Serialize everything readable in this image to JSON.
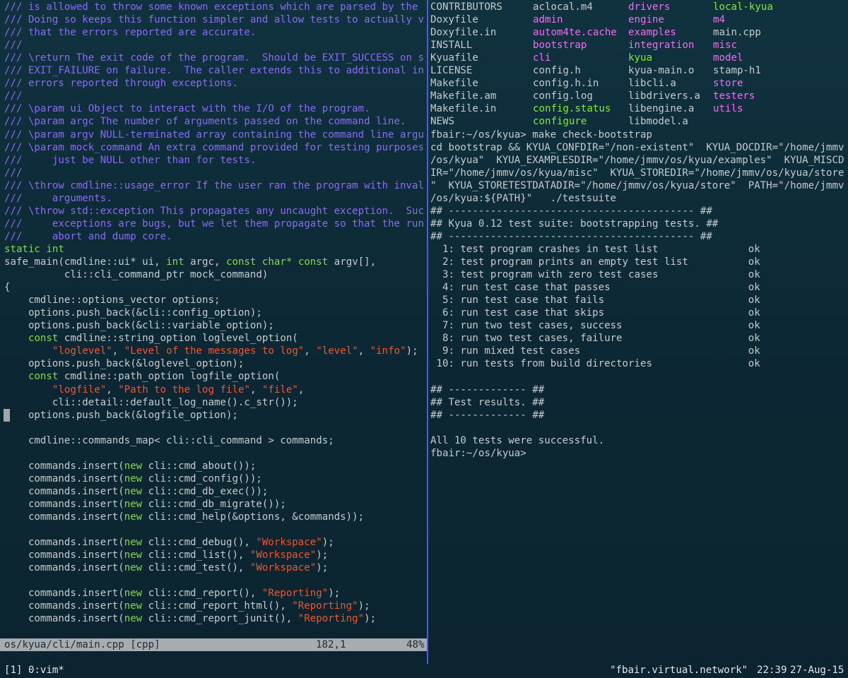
{
  "editor": {
    "lines": [
      [
        {
          "t": "/// is allowed to throw some known exceptions which are parsed by the",
          "c": "comment"
        }
      ],
      [
        {
          "t": "/// Doing so keeps this function simpler and allow tests to actually v",
          "c": "comment"
        }
      ],
      [
        {
          "t": "/// that the errors reported are accurate.",
          "c": "comment"
        }
      ],
      [
        {
          "t": "///",
          "c": "comment"
        }
      ],
      [
        {
          "t": "/// \\return The exit code of the program.  Should be EXIT_SUCCESS on s",
          "c": "comment"
        }
      ],
      [
        {
          "t": "/// EXIT_FAILURE on failure.  The caller extends this to additional in",
          "c": "comment"
        }
      ],
      [
        {
          "t": "/// errors reported through exceptions.",
          "c": "comment"
        }
      ],
      [
        {
          "t": "///",
          "c": "comment"
        }
      ],
      [
        {
          "t": "/// \\param ui Object to interact with the I/O of the program.",
          "c": "comment"
        }
      ],
      [
        {
          "t": "/// \\param argc The number of arguments passed on the command line.",
          "c": "comment"
        }
      ],
      [
        {
          "t": "/// \\param argv NULL-terminated array containing the command line argu",
          "c": "comment"
        }
      ],
      [
        {
          "t": "/// \\param mock_command An extra command provided for testing purposes",
          "c": "comment"
        }
      ],
      [
        {
          "t": "///     just be NULL other than for tests.",
          "c": "comment"
        }
      ],
      [
        {
          "t": "///",
          "c": "comment"
        }
      ],
      [
        {
          "t": "/// \\throw cmdline::usage_error If the user ran the program with inval",
          "c": "comment"
        }
      ],
      [
        {
          "t": "///     arguments.",
          "c": "comment"
        }
      ],
      [
        {
          "t": "/// \\throw std::exception This propagates any uncaught exception.  Suc",
          "c": "comment"
        }
      ],
      [
        {
          "t": "///     exceptions are bugs, but we let them propagate so that the run",
          "c": "comment"
        }
      ],
      [
        {
          "t": "///     abort and dump core.",
          "c": "comment"
        }
      ],
      [
        {
          "t": "static int",
          "c": "type"
        }
      ],
      [
        {
          "t": "safe_main(cmdline::ui* ui, ",
          "c": "plain"
        },
        {
          "t": "int",
          "c": "type"
        },
        {
          "t": " argc, ",
          "c": "plain"
        },
        {
          "t": "const char*",
          "c": "type"
        },
        {
          "t": " ",
          "c": "plain"
        },
        {
          "t": "const",
          "c": "type"
        },
        {
          "t": " argv[],",
          "c": "plain"
        }
      ],
      [
        {
          "t": "          cli::cli_command_ptr mock_command)",
          "c": "plain"
        }
      ],
      [
        {
          "t": "{",
          "c": "plain"
        }
      ],
      [
        {
          "t": "    cmdline::options_vector options;",
          "c": "plain"
        }
      ],
      [
        {
          "t": "    options.push_back(&cli::config_option);",
          "c": "plain"
        }
      ],
      [
        {
          "t": "    options.push_back(&cli::variable_option);",
          "c": "plain"
        }
      ],
      [
        {
          "t": "    ",
          "c": "plain"
        },
        {
          "t": "const",
          "c": "type"
        },
        {
          "t": " cmdline::string_option loglevel_option(",
          "c": "plain"
        }
      ],
      [
        {
          "t": "        ",
          "c": "plain"
        },
        {
          "t": "\"loglevel\"",
          "c": "str"
        },
        {
          "t": ", ",
          "c": "plain"
        },
        {
          "t": "\"Level of the messages to log\"",
          "c": "str"
        },
        {
          "t": ", ",
          "c": "plain"
        },
        {
          "t": "\"level\"",
          "c": "str"
        },
        {
          "t": ", ",
          "c": "plain"
        },
        {
          "t": "\"info\"",
          "c": "str"
        },
        {
          "t": ");",
          "c": "plain"
        }
      ],
      [
        {
          "t": "    options.push_back(&loglevel_option);",
          "c": "plain"
        }
      ],
      [
        {
          "t": "    ",
          "c": "plain"
        },
        {
          "t": "const",
          "c": "type"
        },
        {
          "t": " cmdline::path_option logfile_option(",
          "c": "plain"
        }
      ],
      [
        {
          "t": "        ",
          "c": "plain"
        },
        {
          "t": "\"logfile\"",
          "c": "str"
        },
        {
          "t": ", ",
          "c": "plain"
        },
        {
          "t": "\"Path to the log file\"",
          "c": "str"
        },
        {
          "t": ", ",
          "c": "plain"
        },
        {
          "t": "\"file\"",
          "c": "str"
        },
        {
          "t": ",",
          "c": "plain"
        }
      ],
      [
        {
          "t": "        cli::detail::default_log_name().c_str());",
          "c": "plain"
        }
      ],
      [
        {
          "t": "    options.push_back(&logfile_option);",
          "c": "plain"
        }
      ],
      [
        {
          "t": "",
          "c": "plain"
        }
      ],
      [
        {
          "t": "    cmdline::commands_map< cli::cli_command > commands;",
          "c": "plain"
        }
      ],
      [
        {
          "t": "",
          "c": "plain"
        }
      ],
      [
        {
          "t": "    commands.insert(",
          "c": "plain"
        },
        {
          "t": "new",
          "c": "type"
        },
        {
          "t": " cli::cmd_about());",
          "c": "plain"
        }
      ],
      [
        {
          "t": "    commands.insert(",
          "c": "plain"
        },
        {
          "t": "new",
          "c": "type"
        },
        {
          "t": " cli::cmd_config());",
          "c": "plain"
        }
      ],
      [
        {
          "t": "    commands.insert(",
          "c": "plain"
        },
        {
          "t": "new",
          "c": "type"
        },
        {
          "t": " cli::cmd_db_exec());",
          "c": "plain"
        }
      ],
      [
        {
          "t": "    commands.insert(",
          "c": "plain"
        },
        {
          "t": "new",
          "c": "type"
        },
        {
          "t": " cli::cmd_db_migrate());",
          "c": "plain"
        }
      ],
      [
        {
          "t": "    commands.insert(",
          "c": "plain"
        },
        {
          "t": "new",
          "c": "type"
        },
        {
          "t": " cli::cmd_help(&options, &commands));",
          "c": "plain"
        }
      ],
      [
        {
          "t": "",
          "c": "plain"
        }
      ],
      [
        {
          "t": "    commands.insert(",
          "c": "plain"
        },
        {
          "t": "new",
          "c": "type"
        },
        {
          "t": " cli::cmd_debug(), ",
          "c": "plain"
        },
        {
          "t": "\"Workspace\"",
          "c": "str"
        },
        {
          "t": ");",
          "c": "plain"
        }
      ],
      [
        {
          "t": "    commands.insert(",
          "c": "plain"
        },
        {
          "t": "new",
          "c": "type"
        },
        {
          "t": " cli::cmd_list(), ",
          "c": "plain"
        },
        {
          "t": "\"Workspace\"",
          "c": "str"
        },
        {
          "t": ");",
          "c": "plain"
        }
      ],
      [
        {
          "t": "    commands.insert(",
          "c": "plain"
        },
        {
          "t": "new",
          "c": "type"
        },
        {
          "t": " cli::cmd_test(), ",
          "c": "plain"
        },
        {
          "t": "\"Workspace\"",
          "c": "str"
        },
        {
          "t": ");",
          "c": "plain"
        }
      ],
      [
        {
          "t": "",
          "c": "plain"
        }
      ],
      [
        {
          "t": "    commands.insert(",
          "c": "plain"
        },
        {
          "t": "new",
          "c": "type"
        },
        {
          "t": " cli::cmd_report(), ",
          "c": "plain"
        },
        {
          "t": "\"Reporting\"",
          "c": "str"
        },
        {
          "t": ");",
          "c": "plain"
        }
      ],
      [
        {
          "t": "    commands.insert(",
          "c": "plain"
        },
        {
          "t": "new",
          "c": "type"
        },
        {
          "t": " cli::cmd_report_html(), ",
          "c": "plain"
        },
        {
          "t": "\"Reporting\"",
          "c": "str"
        },
        {
          "t": ");",
          "c": "plain"
        }
      ],
      [
        {
          "t": "    commands.insert(",
          "c": "plain"
        },
        {
          "t": "new",
          "c": "type"
        },
        {
          "t": " cli::cmd_report_junit(), ",
          "c": "plain"
        },
        {
          "t": "\"Reporting\"",
          "c": "str"
        },
        {
          "t": ");",
          "c": "plain"
        }
      ]
    ],
    "statusline": {
      "file": "os/kyua/cli/main.cpp [cpp]",
      "position": "182,1",
      "percent": "48%"
    }
  },
  "terminal": {
    "listing": [
      [
        {
          "t": "CONTRIBUTORS",
          "c": "file"
        },
        {
          "t": "aclocal.m4",
          "c": "file"
        },
        {
          "t": "drivers",
          "c": "dir"
        },
        {
          "t": "local-kyua",
          "c": "exe"
        }
      ],
      [
        {
          "t": "Doxyfile",
          "c": "file"
        },
        {
          "t": "admin",
          "c": "dir"
        },
        {
          "t": "engine",
          "c": "dir"
        },
        {
          "t": "m4",
          "c": "dir"
        }
      ],
      [
        {
          "t": "Doxyfile.in",
          "c": "file"
        },
        {
          "t": "autom4te.cache",
          "c": "dir"
        },
        {
          "t": "examples",
          "c": "dir"
        },
        {
          "t": "main.cpp",
          "c": "file"
        }
      ],
      [
        {
          "t": "INSTALL",
          "c": "file"
        },
        {
          "t": "bootstrap",
          "c": "dir"
        },
        {
          "t": "integration",
          "c": "dir"
        },
        {
          "t": "misc",
          "c": "dir"
        }
      ],
      [
        {
          "t": "Kyuafile",
          "c": "file"
        },
        {
          "t": "cli",
          "c": "dir"
        },
        {
          "t": "kyua",
          "c": "exe"
        },
        {
          "t": "model",
          "c": "dir"
        }
      ],
      [
        {
          "t": "LICENSE",
          "c": "file"
        },
        {
          "t": "config.h",
          "c": "file"
        },
        {
          "t": "kyua-main.o",
          "c": "file"
        },
        {
          "t": "stamp-h1",
          "c": "file"
        }
      ],
      [
        {
          "t": "Makefile",
          "c": "file"
        },
        {
          "t": "config.h.in",
          "c": "file"
        },
        {
          "t": "libcli.a",
          "c": "file"
        },
        {
          "t": "store",
          "c": "dir"
        }
      ],
      [
        {
          "t": "Makefile.am",
          "c": "file"
        },
        {
          "t": "config.log",
          "c": "file"
        },
        {
          "t": "libdrivers.a",
          "c": "file"
        },
        {
          "t": "testers",
          "c": "dir"
        }
      ],
      [
        {
          "t": "Makefile.in",
          "c": "file"
        },
        {
          "t": "config.status",
          "c": "exe"
        },
        {
          "t": "libengine.a",
          "c": "file"
        },
        {
          "t": "utils",
          "c": "dir"
        }
      ],
      [
        {
          "t": "NEWS",
          "c": "file"
        },
        {
          "t": "configure",
          "c": "exe"
        },
        {
          "t": "libmodel.a",
          "c": "file"
        },
        {
          "t": "",
          "c": "file"
        }
      ]
    ],
    "output": [
      "fbair:~/os/kyua> make check-bootstrap",
      "cd bootstrap && KYUA_CONFDIR=\"/non-existent\"  KYUA_DOCDIR=\"/home/jmmv",
      "/os/kyua\"  KYUA_EXAMPLESDIR=\"/home/jmmv/os/kyua/examples\"  KYUA_MISCD",
      "IR=\"/home/jmmv/os/kyua/misc\"  KYUA_STOREDIR=\"/home/jmmv/os/kyua/store",
      "\"  KYUA_STORETESTDATADIR=\"/home/jmmv/os/kyua/store\"  PATH=\"/home/jmmv",
      "/os/kyua:${PATH}\"   ./testsuite",
      "## ----------------------------------------- ##",
      "## Kyua 0.12 test suite: bootstrapping tests. ##",
      "## ----------------------------------------- ##",
      "  1: test program crashes in test list               ok",
      "  2: test program prints an empty test list          ok",
      "  3: test program with zero test cases               ok",
      "  4: run test case that passes                       ok",
      "  5: run test case that fails                        ok",
      "  6: run test case that skips                        ok",
      "  7: run two test cases, success                     ok",
      "  8: run two test cases, failure                     ok",
      "  9: run mixed test cases                            ok",
      " 10: run tests from build directories                ok",
      "",
      "## ------------- ##",
      "## Test results. ##",
      "## ------------- ##",
      "",
      "All 10 tests were successful.",
      "fbair:~/os/kyua>"
    ]
  },
  "tmux": {
    "window": "[1] 0:vim*",
    "host": "\"fbair.virtual.network\"",
    "time": "22:39",
    "date": "27-Aug-15"
  }
}
